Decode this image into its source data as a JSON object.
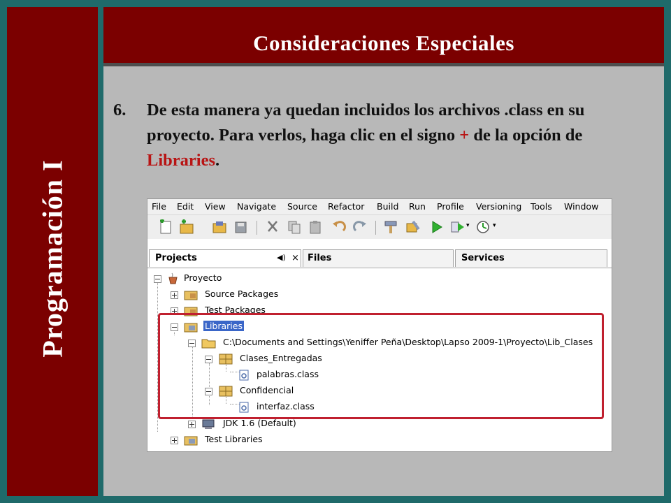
{
  "sidebar": {
    "title": "Programación I"
  },
  "header": {
    "title": "Consideraciones Especiales"
  },
  "step": {
    "number": "6.",
    "text_part1": "De esta manera ya quedan incluidos los archivos .class en su proyecto. Para verlos, haga clic en el signo ",
    "plus": "+",
    "text_part2": " de la opción de ",
    "libraries": "Libraries",
    "text_part3": "."
  },
  "ide": {
    "menu": [
      "File",
      "Edit",
      "View",
      "Navigate",
      "Source",
      "Refactor",
      "Build",
      "Run",
      "Profile",
      "Versioning",
      "Tools",
      "Window"
    ],
    "tabs": {
      "projects": "Projects",
      "files": "Files",
      "services": "Services"
    },
    "tree": {
      "proyecto": "Proyecto",
      "source_packages": "Source Packages",
      "test_packages": "Test Packages",
      "libraries": "Libraries",
      "lib_path": "C:\\Documents and Settings\\Yeniffer Peña\\Desktop\\Lapso 2009-1\\Proyecto\\Lib_Clases",
      "clases_entregadas": "Clases_Entregadas",
      "palabras": "palabras.class",
      "confidencial": "Confidencial",
      "interfaz": "interfaz.class",
      "jdk": "JDK 1.6 (Default)",
      "test_libraries": "Test Libraries"
    }
  },
  "colors": {
    "maroon": "#7b0000",
    "teal": "#1f6a6a",
    "content_bg": "#b8b8b8",
    "accent_red": "#b81414",
    "selection": "#3a66c8"
  }
}
